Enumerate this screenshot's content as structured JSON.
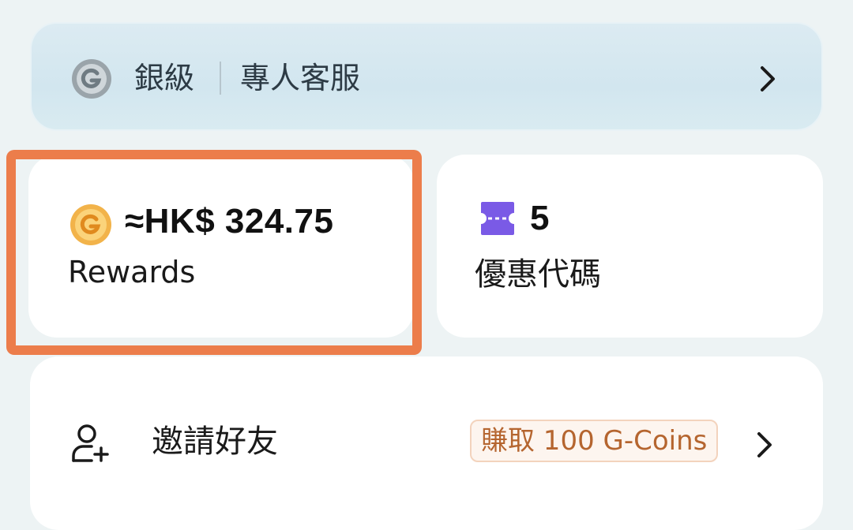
{
  "tier": {
    "level_label": "銀級",
    "service_label": "專人客服"
  },
  "rewards": {
    "amount": "≈HK$ 324.75",
    "label": "Rewards"
  },
  "coupons": {
    "count": "5",
    "label": "優惠代碼"
  },
  "invite": {
    "label": "邀請好友",
    "badge": "賺取 100 G-Coins"
  },
  "colors": {
    "highlight": "#ec7d4b",
    "coin": "#f2a93a",
    "ticket": "#7a5ae6",
    "badge_text": "#b5652f"
  },
  "icons": {
    "tier": "silver-g-badge-icon",
    "rewards": "gold-coin-icon",
    "coupons": "ticket-icon",
    "invite": "add-person-icon",
    "chevron": "chevron-right-icon"
  }
}
